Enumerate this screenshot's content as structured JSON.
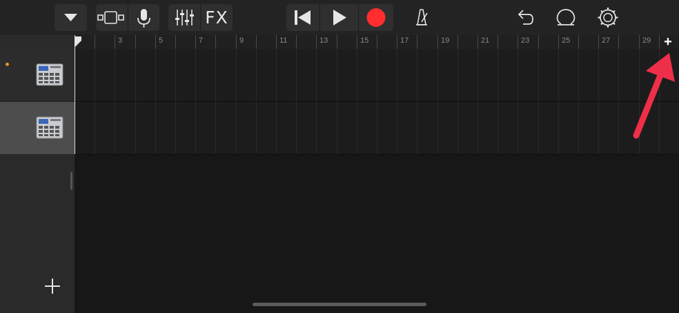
{
  "toolbar": {
    "fx_label": "FX",
    "record_color": "#ff2d2d"
  },
  "icons": [
    "menu-dropdown-icon",
    "track-view-icon",
    "microphone-icon",
    "mixer-icon",
    "go-to-start-icon",
    "play-icon",
    "record-icon",
    "metronome-icon",
    "undo-icon",
    "loop-icon",
    "settings-icon",
    "drum-machine-icon",
    "add-track-icon",
    "add-section-icon"
  ],
  "ruler": {
    "bars": [
      "3",
      "5",
      "7",
      "9",
      "11",
      "13",
      "15",
      "17",
      "19",
      "21",
      "23",
      "25",
      "27",
      "29"
    ]
  },
  "tracks": [
    {
      "instrument_icon": "drum-machine-icon",
      "selected": false,
      "indicator_color": "#e8931d"
    },
    {
      "instrument_icon": "drum-machine-icon",
      "selected": true
    }
  ],
  "add_section_label": "+",
  "annotation": {
    "color": "#ee2f4a"
  }
}
